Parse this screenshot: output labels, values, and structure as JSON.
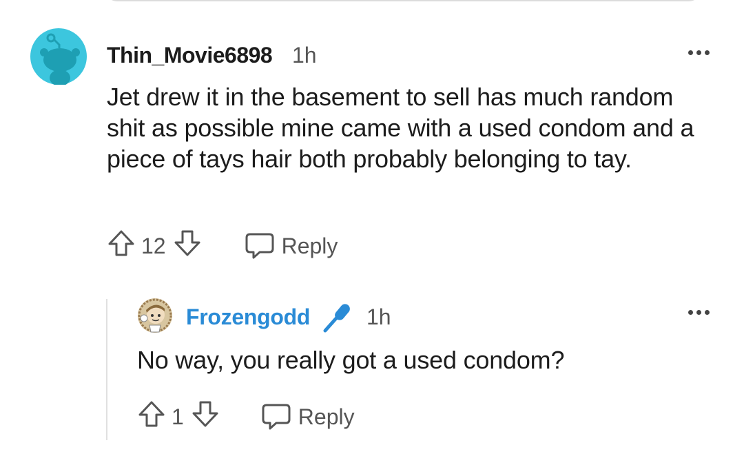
{
  "comment": {
    "author": "Thin_Movie6898",
    "time": "1h",
    "body": "Jet drew it in the basement to sell has much random shit as possible mine came with a used condom and a piece of tays hair both probably belonging to tay.",
    "score": "12",
    "reply_label": "Reply",
    "avatar_icon": "reddit-snoo-avatar-icon",
    "avatar_color": "#3cc6de"
  },
  "reply": {
    "author": "Frozengodd",
    "time": "1h",
    "body": "No way, you really got a used condom?",
    "score": "1",
    "reply_label": "Reply",
    "author_color": "#2a8bd6",
    "badge_icon": "microphone-icon"
  }
}
